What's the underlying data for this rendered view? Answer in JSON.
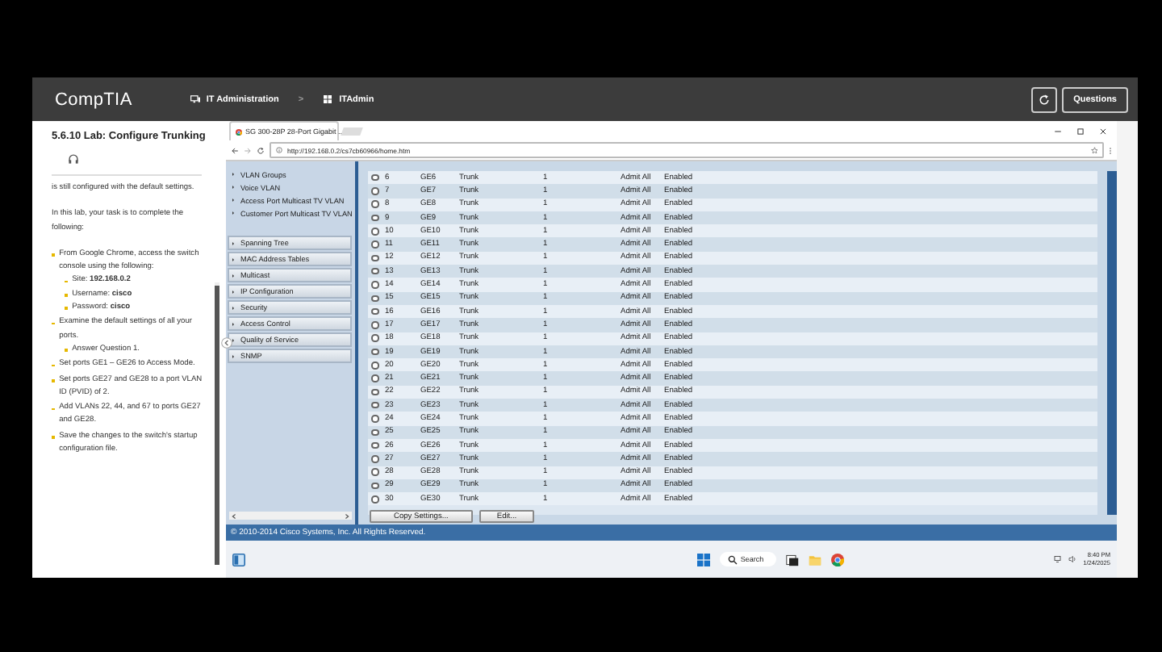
{
  "header": {
    "logo": "CompTIA",
    "breadcrumb": [
      {
        "label": "IT Administration",
        "kind": "monitor"
      },
      {
        "label": "ITAdmin",
        "kind": "windows"
      }
    ],
    "separator": ">",
    "questions_button": "Questions"
  },
  "lab": {
    "title": "5.6.10 Lab: Configure Trunking",
    "intro": "is still configured with the default settings.",
    "task_intro": "In this lab, your task is to complete the following:",
    "tasks": [
      {
        "text": "From Google Chrome, access the switch console using the following:",
        "children": [
          {
            "text": "Site: **192.168.0.2**"
          },
          {
            "text": "Username: **cisco**"
          },
          {
            "text": "Password: **cisco**"
          }
        ]
      },
      {
        "text": "Examine the default settings of all your ports.",
        "children": [
          {
            "text": "Answer Question 1."
          }
        ]
      },
      {
        "text": "Set ports GE1 – GE26 to Access Mode."
      },
      {
        "text": "Set ports GE27 and GE28 to a port VLAN ID (PVID) of 2."
      },
      {
        "text": "Add VLANs 22, 44, and 67 to ports GE27 and GE28."
      },
      {
        "text": "Save the changes to the switch's startup configuration file."
      }
    ]
  },
  "browser": {
    "tab_title": "SG 300-28P 28-Port Gigabit ...",
    "url": "http://192.168.0.2/cs7cb60966/home.htm",
    "nav": [
      {
        "label": "VLAN Groups",
        "kind": "item"
      },
      {
        "label": "Voice VLAN",
        "kind": "item"
      },
      {
        "label": "Access Port Multicast TV VLAN",
        "kind": "item"
      },
      {
        "label": "Customer Port Multicast TV VLAN",
        "kind": "item"
      },
      {
        "label": "Spanning Tree",
        "kind": "section"
      },
      {
        "label": "MAC Address Tables",
        "kind": "section"
      },
      {
        "label": "Multicast",
        "kind": "section"
      },
      {
        "label": "IP Configuration",
        "kind": "section"
      },
      {
        "label": "Security",
        "kind": "section"
      },
      {
        "label": "Access Control",
        "kind": "section"
      },
      {
        "label": "Quality of Service",
        "kind": "section"
      },
      {
        "label": "SNMP",
        "kind": "section"
      }
    ],
    "table": {
      "rows": [
        {
          "selected": false,
          "number": "6",
          "port": "GE6",
          "mode": "Trunk",
          "pvid": "1",
          "frame_type": "Admit All",
          "filtering": "Enabled"
        },
        {
          "selected": false,
          "number": "7",
          "port": "GE7",
          "mode": "Trunk",
          "pvid": "1",
          "frame_type": "Admit All",
          "filtering": "Enabled"
        },
        {
          "selected": false,
          "number": "8",
          "port": "GE8",
          "mode": "Trunk",
          "pvid": "1",
          "frame_type": "Admit All",
          "filtering": "Enabled"
        },
        {
          "selected": false,
          "number": "9",
          "port": "GE9",
          "mode": "Trunk",
          "pvid": "1",
          "frame_type": "Admit All",
          "filtering": "Enabled"
        },
        {
          "selected": false,
          "number": "10",
          "port": "GE10",
          "mode": "Trunk",
          "pvid": "1",
          "frame_type": "Admit All",
          "filtering": "Enabled"
        },
        {
          "selected": false,
          "number": "11",
          "port": "GE11",
          "mode": "Trunk",
          "pvid": "1",
          "frame_type": "Admit All",
          "filtering": "Enabled"
        },
        {
          "selected": false,
          "number": "12",
          "port": "GE12",
          "mode": "Trunk",
          "pvid": "1",
          "frame_type": "Admit All",
          "filtering": "Enabled"
        },
        {
          "selected": false,
          "number": "13",
          "port": "GE13",
          "mode": "Trunk",
          "pvid": "1",
          "frame_type": "Admit All",
          "filtering": "Enabled"
        },
        {
          "selected": false,
          "number": "14",
          "port": "GE14",
          "mode": "Trunk",
          "pvid": "1",
          "frame_type": "Admit All",
          "filtering": "Enabled"
        },
        {
          "selected": false,
          "number": "15",
          "port": "GE15",
          "mode": "Trunk",
          "pvid": "1",
          "frame_type": "Admit All",
          "filtering": "Enabled"
        },
        {
          "selected": false,
          "number": "16",
          "port": "GE16",
          "mode": "Trunk",
          "pvid": "1",
          "frame_type": "Admit All",
          "filtering": "Enabled"
        },
        {
          "selected": false,
          "number": "17",
          "port": "GE17",
          "mode": "Trunk",
          "pvid": "1",
          "frame_type": "Admit All",
          "filtering": "Enabled"
        },
        {
          "selected": false,
          "number": "18",
          "port": "GE18",
          "mode": "Trunk",
          "pvid": "1",
          "frame_type": "Admit All",
          "filtering": "Enabled"
        },
        {
          "selected": false,
          "number": "19",
          "port": "GE19",
          "mode": "Trunk",
          "pvid": "1",
          "frame_type": "Admit All",
          "filtering": "Enabled"
        },
        {
          "selected": false,
          "number": "20",
          "port": "GE20",
          "mode": "Trunk",
          "pvid": "1",
          "frame_type": "Admit All",
          "filtering": "Enabled"
        },
        {
          "selected": false,
          "number": "21",
          "port": "GE21",
          "mode": "Trunk",
          "pvid": "1",
          "frame_type": "Admit All",
          "filtering": "Enabled"
        },
        {
          "selected": false,
          "number": "22",
          "port": "GE22",
          "mode": "Trunk",
          "pvid": "1",
          "frame_type": "Admit All",
          "filtering": "Enabled"
        },
        {
          "selected": false,
          "number": "23",
          "port": "GE23",
          "mode": "Trunk",
          "pvid": "1",
          "frame_type": "Admit All",
          "filtering": "Enabled"
        },
        {
          "selected": false,
          "number": "24",
          "port": "GE24",
          "mode": "Trunk",
          "pvid": "1",
          "frame_type": "Admit All",
          "filtering": "Enabled"
        },
        {
          "selected": false,
          "number": "25",
          "port": "GE25",
          "mode": "Trunk",
          "pvid": "1",
          "frame_type": "Admit All",
          "filtering": "Enabled"
        },
        {
          "selected": false,
          "number": "26",
          "port": "GE26",
          "mode": "Trunk",
          "pvid": "1",
          "frame_type": "Admit All",
          "filtering": "Enabled"
        },
        {
          "selected": false,
          "number": "27",
          "port": "GE27",
          "mode": "Trunk",
          "pvid": "1",
          "frame_type": "Admit All",
          "filtering": "Enabled"
        },
        {
          "selected": false,
          "number": "28",
          "port": "GE28",
          "mode": "Trunk",
          "pvid": "1",
          "frame_type": "Admit All",
          "filtering": "Enabled"
        },
        {
          "selected": false,
          "number": "29",
          "port": "GE29",
          "mode": "Trunk",
          "pvid": "1",
          "frame_type": "Admit All",
          "filtering": "Enabled"
        },
        {
          "selected": false,
          "number": "30",
          "port": "GE30",
          "mode": "Trunk",
          "pvid": "1",
          "frame_type": "Admit All",
          "filtering": "Enabled"
        }
      ],
      "buttons": [
        "Copy Settings...",
        "Edit..."
      ]
    },
    "footer": "© 2010-2014 Cisco Systems, Inc. All Rights Reserved."
  },
  "taskbar": {
    "search": "Search",
    "time": "8:40 PM",
    "date": "1/24/2025"
  }
}
